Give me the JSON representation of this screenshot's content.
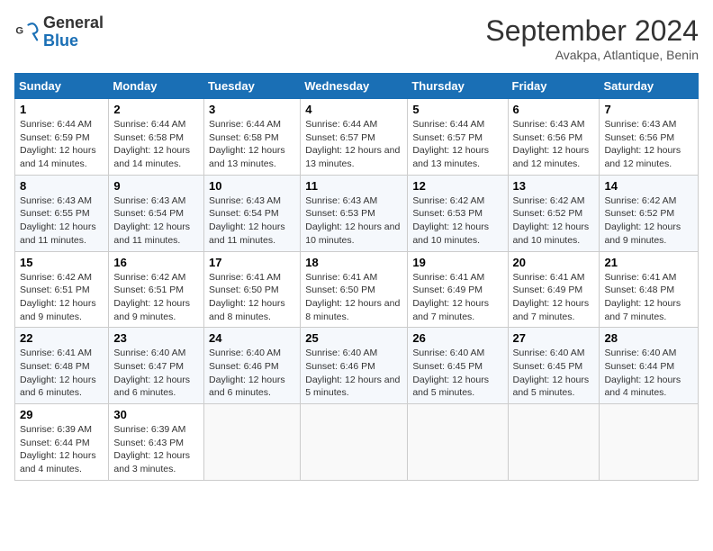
{
  "logo": {
    "text_general": "General",
    "text_blue": "Blue"
  },
  "header": {
    "month": "September 2024",
    "location": "Avakpa, Atlantique, Benin"
  },
  "columns": [
    "Sunday",
    "Monday",
    "Tuesday",
    "Wednesday",
    "Thursday",
    "Friday",
    "Saturday"
  ],
  "weeks": [
    [
      {
        "num": "1",
        "sunrise": "6:44 AM",
        "sunset": "6:59 PM",
        "daylight": "12 hours and 14 minutes."
      },
      {
        "num": "2",
        "sunrise": "6:44 AM",
        "sunset": "6:58 PM",
        "daylight": "12 hours and 14 minutes."
      },
      {
        "num": "3",
        "sunrise": "6:44 AM",
        "sunset": "6:58 PM",
        "daylight": "12 hours and 13 minutes."
      },
      {
        "num": "4",
        "sunrise": "6:44 AM",
        "sunset": "6:57 PM",
        "daylight": "12 hours and 13 minutes."
      },
      {
        "num": "5",
        "sunrise": "6:44 AM",
        "sunset": "6:57 PM",
        "daylight": "12 hours and 13 minutes."
      },
      {
        "num": "6",
        "sunrise": "6:43 AM",
        "sunset": "6:56 PM",
        "daylight": "12 hours and 12 minutes."
      },
      {
        "num": "7",
        "sunrise": "6:43 AM",
        "sunset": "6:56 PM",
        "daylight": "12 hours and 12 minutes."
      }
    ],
    [
      {
        "num": "8",
        "sunrise": "6:43 AM",
        "sunset": "6:55 PM",
        "daylight": "12 hours and 11 minutes."
      },
      {
        "num": "9",
        "sunrise": "6:43 AM",
        "sunset": "6:54 PM",
        "daylight": "12 hours and 11 minutes."
      },
      {
        "num": "10",
        "sunrise": "6:43 AM",
        "sunset": "6:54 PM",
        "daylight": "12 hours and 11 minutes."
      },
      {
        "num": "11",
        "sunrise": "6:43 AM",
        "sunset": "6:53 PM",
        "daylight": "12 hours and 10 minutes."
      },
      {
        "num": "12",
        "sunrise": "6:42 AM",
        "sunset": "6:53 PM",
        "daylight": "12 hours and 10 minutes."
      },
      {
        "num": "13",
        "sunrise": "6:42 AM",
        "sunset": "6:52 PM",
        "daylight": "12 hours and 10 minutes."
      },
      {
        "num": "14",
        "sunrise": "6:42 AM",
        "sunset": "6:52 PM",
        "daylight": "12 hours and 9 minutes."
      }
    ],
    [
      {
        "num": "15",
        "sunrise": "6:42 AM",
        "sunset": "6:51 PM",
        "daylight": "12 hours and 9 minutes."
      },
      {
        "num": "16",
        "sunrise": "6:42 AM",
        "sunset": "6:51 PM",
        "daylight": "12 hours and 9 minutes."
      },
      {
        "num": "17",
        "sunrise": "6:41 AM",
        "sunset": "6:50 PM",
        "daylight": "12 hours and 8 minutes."
      },
      {
        "num": "18",
        "sunrise": "6:41 AM",
        "sunset": "6:50 PM",
        "daylight": "12 hours and 8 minutes."
      },
      {
        "num": "19",
        "sunrise": "6:41 AM",
        "sunset": "6:49 PM",
        "daylight": "12 hours and 7 minutes."
      },
      {
        "num": "20",
        "sunrise": "6:41 AM",
        "sunset": "6:49 PM",
        "daylight": "12 hours and 7 minutes."
      },
      {
        "num": "21",
        "sunrise": "6:41 AM",
        "sunset": "6:48 PM",
        "daylight": "12 hours and 7 minutes."
      }
    ],
    [
      {
        "num": "22",
        "sunrise": "6:41 AM",
        "sunset": "6:48 PM",
        "daylight": "12 hours and 6 minutes."
      },
      {
        "num": "23",
        "sunrise": "6:40 AM",
        "sunset": "6:47 PM",
        "daylight": "12 hours and 6 minutes."
      },
      {
        "num": "24",
        "sunrise": "6:40 AM",
        "sunset": "6:46 PM",
        "daylight": "12 hours and 6 minutes."
      },
      {
        "num": "25",
        "sunrise": "6:40 AM",
        "sunset": "6:46 PM",
        "daylight": "12 hours and 5 minutes."
      },
      {
        "num": "26",
        "sunrise": "6:40 AM",
        "sunset": "6:45 PM",
        "daylight": "12 hours and 5 minutes."
      },
      {
        "num": "27",
        "sunrise": "6:40 AM",
        "sunset": "6:45 PM",
        "daylight": "12 hours and 5 minutes."
      },
      {
        "num": "28",
        "sunrise": "6:40 AM",
        "sunset": "6:44 PM",
        "daylight": "12 hours and 4 minutes."
      }
    ],
    [
      {
        "num": "29",
        "sunrise": "6:39 AM",
        "sunset": "6:44 PM",
        "daylight": "12 hours and 4 minutes."
      },
      {
        "num": "30",
        "sunrise": "6:39 AM",
        "sunset": "6:43 PM",
        "daylight": "12 hours and 3 minutes."
      },
      null,
      null,
      null,
      null,
      null
    ]
  ]
}
